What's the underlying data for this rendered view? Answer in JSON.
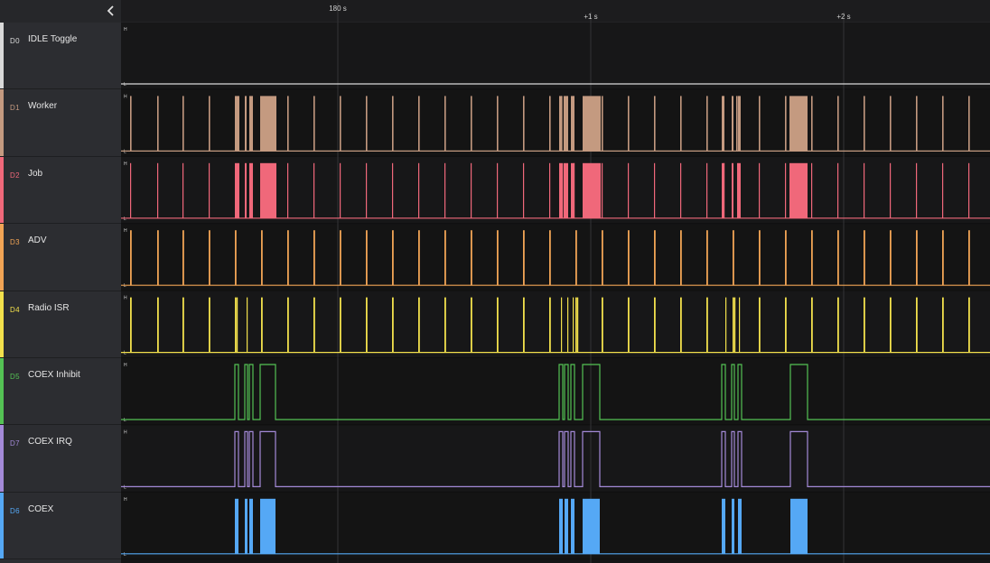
{
  "sidebar": {
    "collapse_icon": "chevron-left-icon",
    "channels": [
      {
        "id": "D0",
        "name": "IDLE Toggle",
        "color": "#d9d9d9"
      },
      {
        "id": "D1",
        "name": "Worker",
        "color": "#c49a80"
      },
      {
        "id": "D2",
        "name": "Job",
        "color": "#f0687a"
      },
      {
        "id": "D3",
        "name": "ADV",
        "color": "#f1a455"
      },
      {
        "id": "D4",
        "name": "Radio ISR",
        "color": "#f2e04c"
      },
      {
        "id": "D5",
        "name": "COEX Inhibit",
        "color": "#54c254"
      },
      {
        "id": "D7",
        "name": "COEX IRQ",
        "color": "#a48ad8"
      },
      {
        "id": "D6",
        "name": "COEX",
        "color": "#55a8f5"
      }
    ]
  },
  "timeline": {
    "ticks": [
      {
        "label": "180 s"
      },
      {
        "label": "+1 s"
      },
      {
        "label": "+2 s"
      }
    ],
    "level_high": "H",
    "level_low": "L"
  }
}
